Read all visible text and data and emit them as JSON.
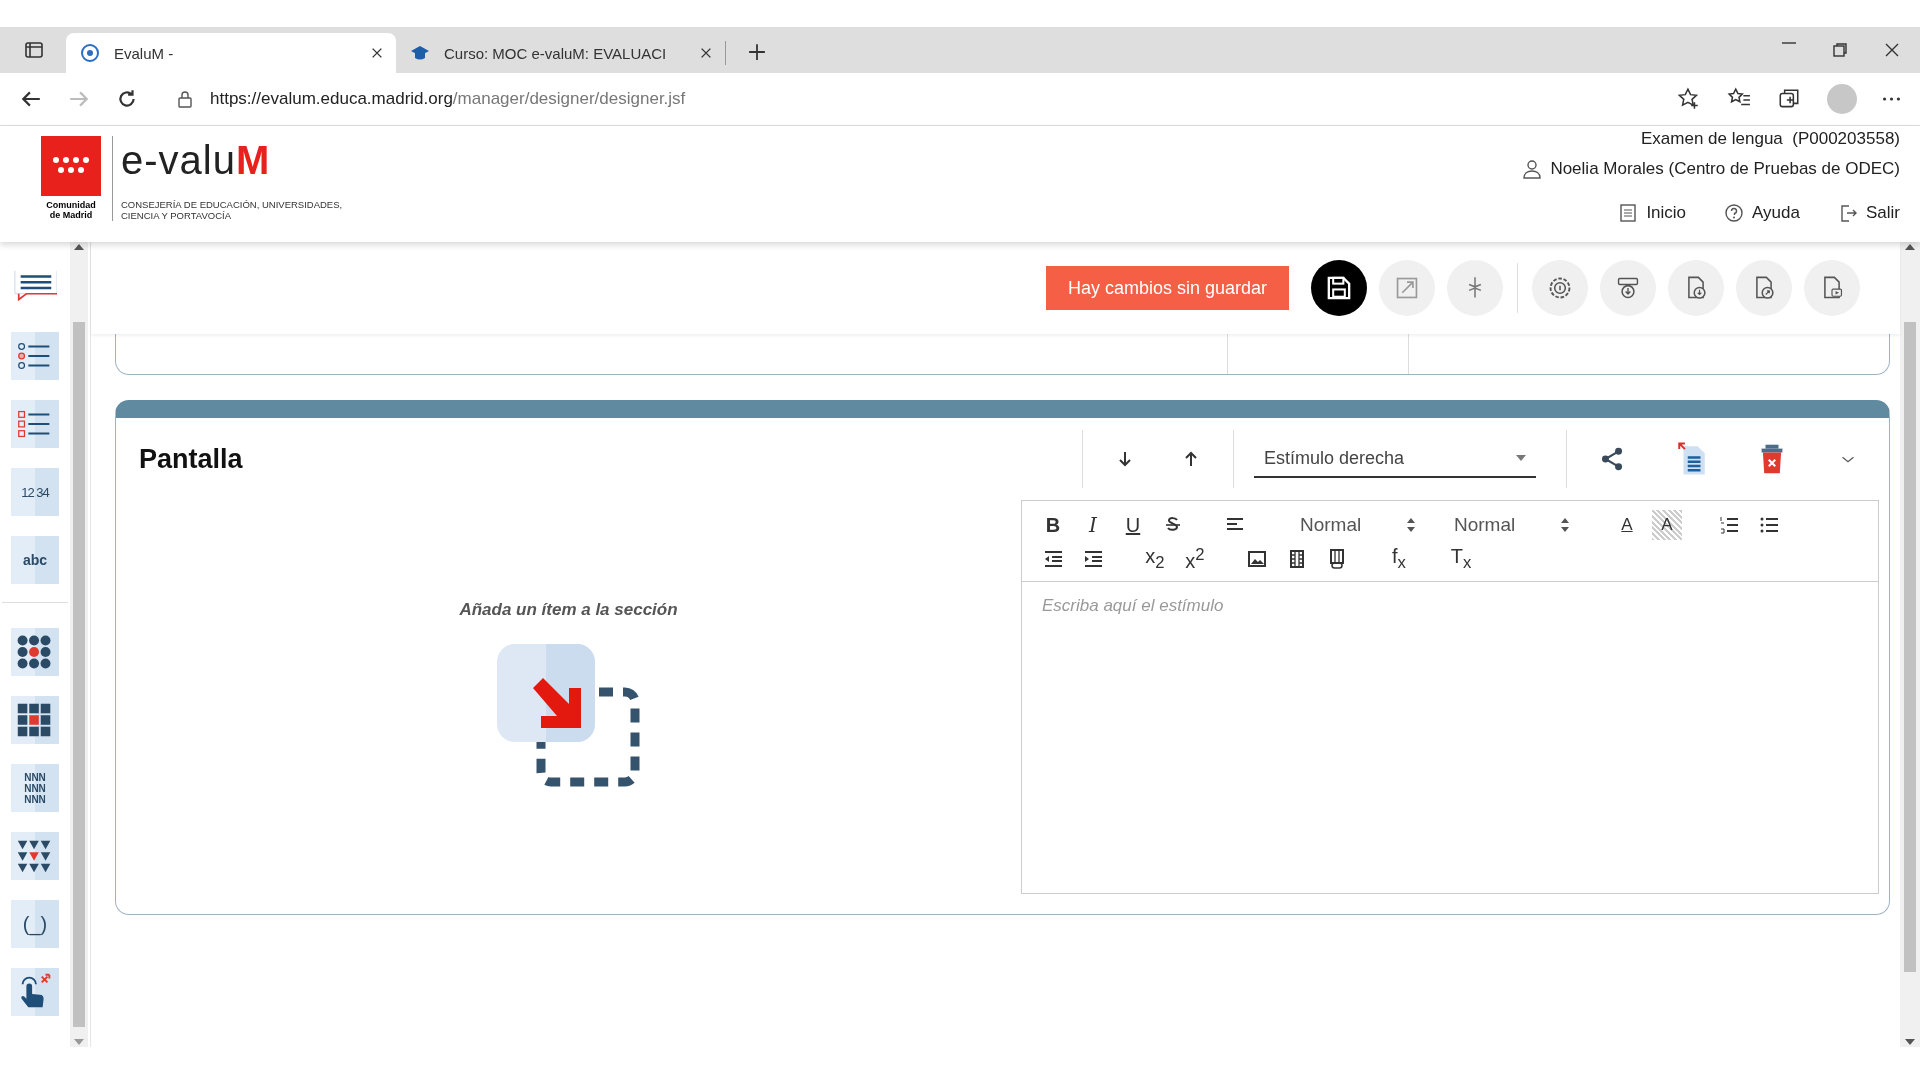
{
  "browser": {
    "tabs": [
      {
        "title": "EvaluM -",
        "selected": true
      },
      {
        "title": "Curso: MOC e-valuM: EVALUACI",
        "selected": false
      }
    ],
    "url_host": "https://evalum.educa.madrid.org",
    "url_path": "/manager/designer/designer.jsf"
  },
  "header": {
    "logo": "e-valu**M**",
    "region": "Comunidad de Madrid",
    "department": "CONSEJERÍA DE EDUCACIÓN, UNIVERSIDADES, CIENCIA Y PORTAVOCÍA",
    "exam": "Examen de lengua  (P000203558)",
    "user": "Noelia Morales (Centro de Pruebas de ODEC)",
    "links": [
      {
        "kind": "home",
        "label": "Inicio"
      },
      {
        "kind": "help",
        "label": "Ayuda"
      },
      {
        "kind": "exit",
        "label": "Salir"
      }
    ]
  },
  "sidebar": {
    "groups": [
      [
        {
          "kind": "text-response"
        },
        {
          "kind": "single-choice"
        },
        {
          "kind": "multiple-choice"
        },
        {
          "kind": "numeric",
          "label": "12 34"
        },
        {
          "kind": "text-entry",
          "label": "abc"
        }
      ],
      [
        {
          "kind": "dot-grid"
        },
        {
          "kind": "square-grid"
        },
        {
          "kind": "letter-grid",
          "label": "NNN NNN NNN"
        },
        {
          "kind": "triangle-grid"
        },
        {
          "kind": "gap",
          "label": "(_)"
        },
        {
          "kind": "hotspot"
        }
      ]
    ]
  },
  "toolbar": {
    "status": "Hay cambios sin guardar",
    "groups": [
      [
        {
          "kind": "save",
          "highlighted": true
        },
        {
          "kind": "expand",
          "highlighted": false
        },
        {
          "kind": "collapse",
          "highlighted": false
        }
      ],
      [
        {
          "kind": "settings",
          "highlighted": false
        },
        {
          "kind": "download-info",
          "highlighted": false
        },
        {
          "kind": "export-download",
          "highlighted": false
        },
        {
          "kind": "export-share",
          "highlighted": false
        },
        {
          "kind": "document-video",
          "highlighted": false
        }
      ]
    ]
  },
  "section": {
    "title": "Pantalla",
    "layout": "Estímulo derecha",
    "empty_message": "Añada un ítem a la sección",
    "editor": {
      "format_rows": [
        [
          {
            "kind": "text",
            "label": "B"
          },
          {
            "kind": "text",
            "label": "I"
          },
          {
            "kind": "text",
            "label": "U"
          },
          {
            "kind": "strike"
          },
          {
            "kind": "align"
          },
          {
            "kind": "select",
            "label": "Normal"
          },
          {
            "kind": "select",
            "label": "Normal"
          },
          {
            "kind": "text",
            "label": "A"
          },
          {
            "kind": "text",
            "label": "A"
          },
          {
            "kind": "ordered-list"
          },
          {
            "kind": "bullet-list"
          }
        ],
        [
          {
            "kind": "outdent"
          },
          {
            "kind": "indent"
          },
          {
            "kind": "text",
            "label": "x$_{2}$"
          },
          {
            "kind": "text",
            "label": "x$^{2}$"
          },
          {
            "kind": "image"
          },
          {
            "kind": "video"
          },
          {
            "kind": "link-video"
          },
          {
            "kind": "text",
            "label": "f$_{x}$"
          },
          {
            "kind": "text",
            "label": "T$_{x}$"
          }
        ]
      ],
      "placeholder": "Escriba aquí el estímulo"
    }
  }
}
